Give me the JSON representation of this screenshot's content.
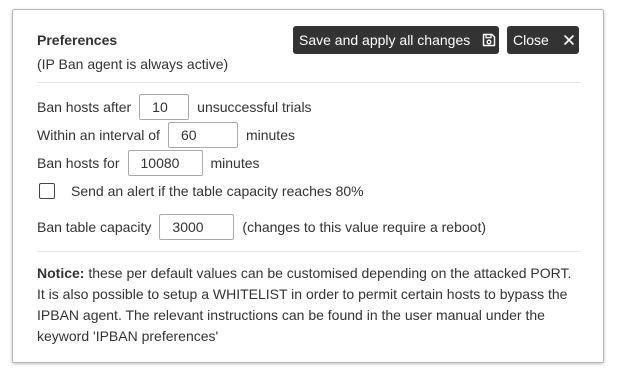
{
  "preferences": {
    "title": "Preferences",
    "subtitle": "(IP Ban agent is always active)"
  },
  "toolbar": {
    "save_label": "Save and apply all changes",
    "save_icon": "floppy-disk-icon",
    "close_label": "Close",
    "close_icon": "close-x-icon"
  },
  "fields": {
    "ban_after": {
      "prefix": "Ban hosts after",
      "value": "10",
      "suffix": "unsuccessful trials"
    },
    "interval": {
      "prefix": "Within an interval of",
      "value": "60",
      "suffix": "minutes"
    },
    "ban_for": {
      "prefix": "Ban hosts for",
      "value": "10080",
      "suffix": "minutes"
    },
    "alert": {
      "label": "Send an alert if the table capacity reaches 80%",
      "checked": false
    },
    "capacity": {
      "prefix": "Ban table capacity",
      "value": "3000",
      "suffix": "(changes to this value require a reboot)"
    }
  },
  "notice": {
    "heading": "Notice:",
    "text": " these per default values can be customised depending on the attacked PORT. It is also possible to setup a WHITELIST in order to permit certain hosts to bypass the IPBAN agent. The relevant instructions can be found in the user manual under the keyword 'IPBAN preferences'"
  }
}
